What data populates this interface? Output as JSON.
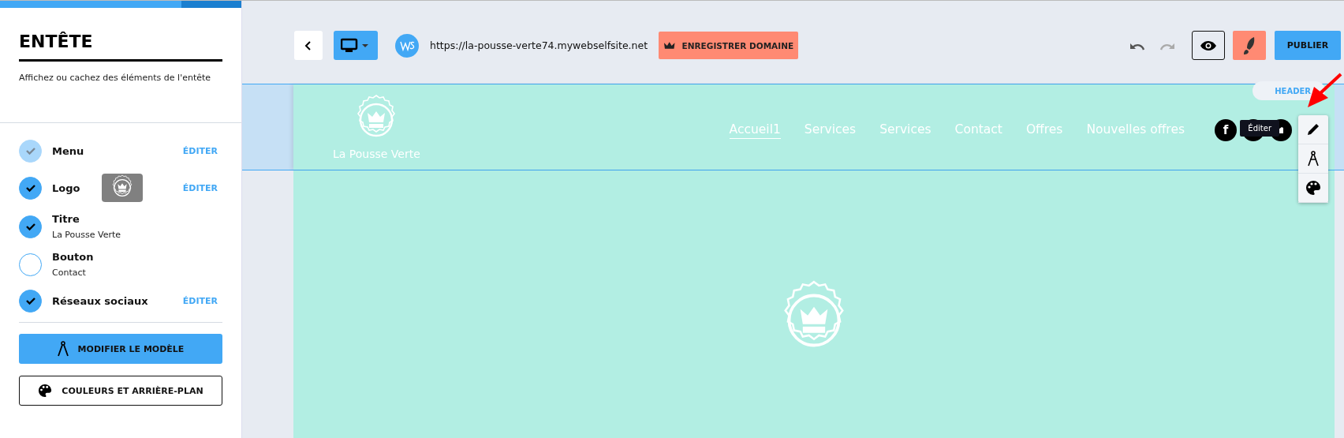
{
  "progress": {
    "level": 0.75
  },
  "panel": {
    "title": "ENTÊTE",
    "description": "Affichez ou cachez des éléments de l'entête",
    "items": [
      {
        "kind": "locked",
        "label": "Menu",
        "checked": true,
        "action": "ÉDITER"
      },
      {
        "kind": "logo",
        "label": "Logo",
        "checked": true,
        "action": "ÉDITER"
      },
      {
        "kind": "plain",
        "label": "Titre",
        "checked": true,
        "detail": "La Pousse Verte"
      },
      {
        "kind": "plain",
        "label": "Bouton",
        "checked": false,
        "detail": "Contact"
      },
      {
        "kind": "plain",
        "label": "Réseaux sociaux",
        "checked": true,
        "action": "ÉDITER"
      }
    ],
    "buttons": [
      {
        "kind": "primary",
        "label": "MODIFIER LE MODÈLE"
      },
      {
        "kind": "outline",
        "label": "COULEURS ET ARRIÈRE-PLAN"
      }
    ]
  },
  "toolbar": {
    "url": "https://la-pousse-verte74.mywebselfsite.net",
    "domain_button": "ENREGISTRER DOMAINE",
    "publish_button": "PUBLIER"
  },
  "site_header": {
    "badge": "HEADER",
    "site_title": "La Pousse Verte",
    "nav": [
      {
        "label": "Accueil1",
        "selected": true
      },
      {
        "label": "Services",
        "selected": false
      },
      {
        "label": "Services",
        "selected": false
      },
      {
        "label": "Contact",
        "selected": false
      },
      {
        "label": "Offres",
        "selected": false
      },
      {
        "label": "Nouvelles offres",
        "selected": false
      }
    ],
    "social": [
      {
        "kind": "facebook",
        "glyph": "f"
      },
      {
        "kind": "covered"
      },
      {
        "kind": "other"
      }
    ],
    "tooltip": "Éditer"
  }
}
